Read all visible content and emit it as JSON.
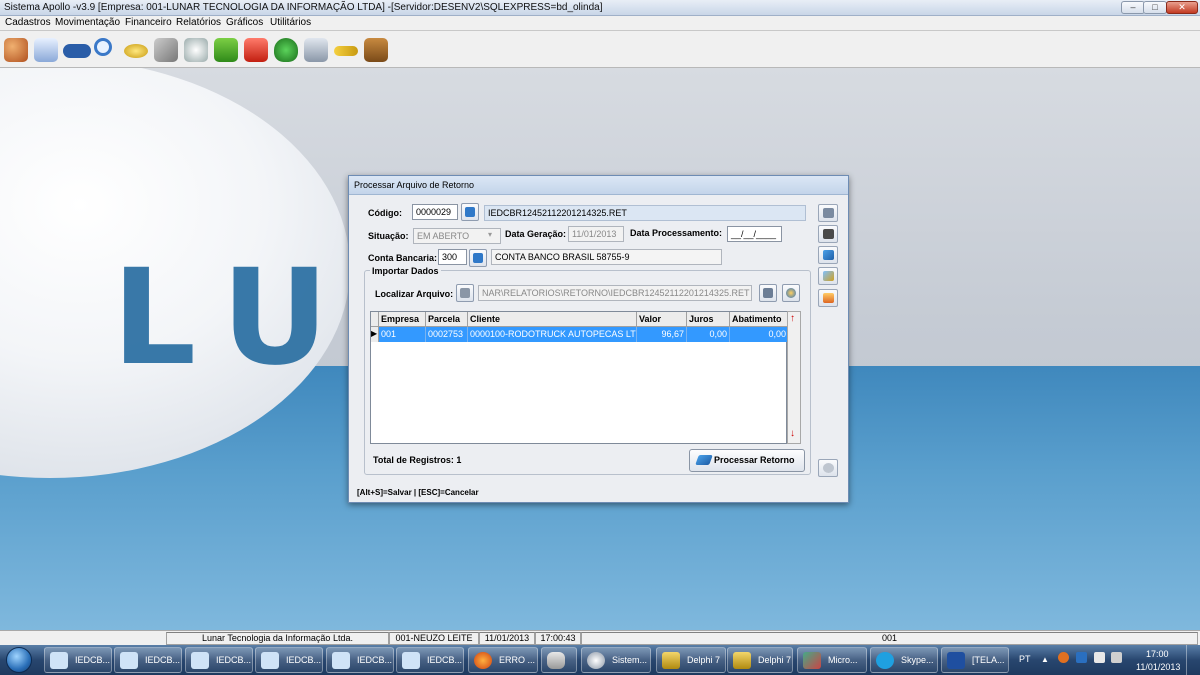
{
  "window": {
    "title": "Sistema Apollo -v3.9 [Empresa: 001-LUNAR TECNOLOGIA DA INFORMAÇÃO LTDA] -[Servidor:DESENV2\\SQLEXPRESS=bd_olinda]",
    "controls": {
      "minimize": "–",
      "maximize": "□",
      "close": "✕"
    }
  },
  "menu": [
    "Cadastros",
    "Movimentação",
    "Financeiro",
    "Relatórios",
    "Gráficos",
    "Utilitários"
  ],
  "toolbar": {
    "icons": [
      "users-icon",
      "calendar-icon",
      "car-icon",
      "search-icon",
      "coins-icon",
      "tools-icon",
      "clock-icon",
      "folder-green-icon",
      "folder-red-icon",
      "money-bag-icon",
      "calculator-icon",
      "key-icon",
      "exit-door-icon"
    ]
  },
  "desktop": {
    "logo_text": "LU"
  },
  "dialog": {
    "title": "Processar Arquivo de Retorno",
    "codigo_label": "Código:",
    "codigo_value": "0000029",
    "arquivo_value": "IEDCBR12452112201214325.RET",
    "situacao_label": "Situação:",
    "situacao_value": "EM ABERTO",
    "data_geracao_label": "Data Geração:",
    "data_geracao_value": "11/01/2013",
    "data_processamento_label": "Data Processamento:",
    "data_processamento_value": "__/__/____",
    "conta_label": "Conta Bancaria:",
    "conta_value": "300",
    "conta_desc": "CONTA BANCO BRASIL 58755-9",
    "importar_label": "Importar Dados",
    "localizar_label": "Localizar Arquivo:",
    "localizar_value": "NAR\\RELATORIOS\\RETORNO\\IEDCBR12452112201214325.RET",
    "columns": [
      "Empresa",
      "Parcela",
      "Cliente",
      "Valor",
      "Juros",
      "Abatimento"
    ],
    "rows": [
      {
        "empresa": "001",
        "parcela": "0002753",
        "cliente": "0000100-RODOTRUCK AUTOPECAS LT",
        "valor": "96,67",
        "juros": "0,00",
        "abatimento": "0,00"
      }
    ],
    "total_label": "Total de Registros: 1",
    "process_button": "Processar Retorno",
    "footer_hint": "[Alt+S]=Salvar | [ESC]=Cancelar",
    "side_buttons": [
      "exit-icon",
      "print-icon",
      "save-icon",
      "cancel-icon",
      "report-icon",
      "refresh-icon"
    ]
  },
  "statusbar": {
    "company": "Lunar Tecnologia da Informação Ltda.",
    "user": "001-NEUZO LEITE",
    "date": "11/01/2013",
    "time": "17:00:43",
    "code": "001"
  },
  "taskbar": {
    "tasks": [
      "IEDCB...",
      "IEDCB...",
      "IEDCB...",
      "IEDCB...",
      "IEDCB...",
      "IEDCB...",
      "ERRO ...",
      "",
      "Sistem...",
      "Delphi 7",
      "Delphi 7",
      "Micro...",
      "Skype...",
      "[TELA..."
    ],
    "language": "PT",
    "clock_time": "17:00",
    "clock_date": "11/01/2013"
  }
}
